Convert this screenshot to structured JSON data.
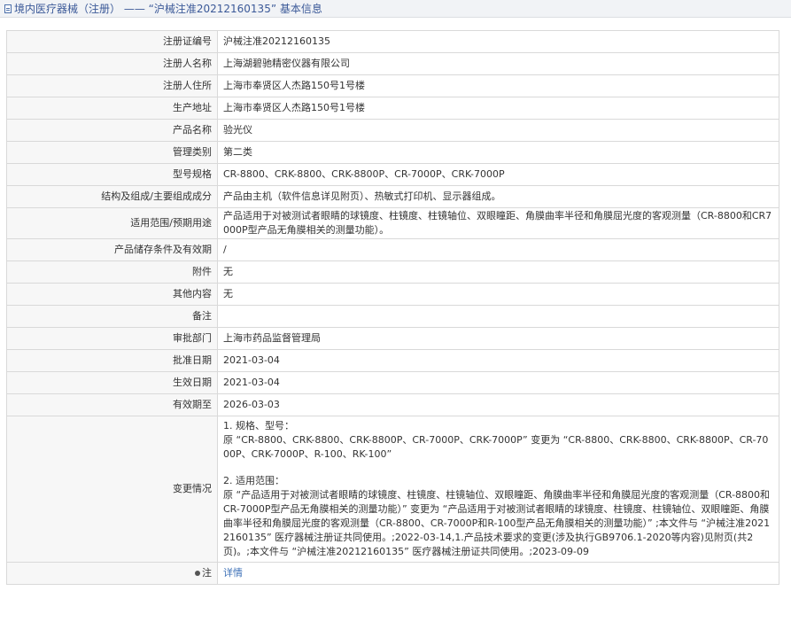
{
  "header": {
    "title": "境内医疗器械（注册） —— “沪械注准20212160135” 基本信息"
  },
  "rows": [
    {
      "label": "注册证编号",
      "value": "沪械注准20212160135"
    },
    {
      "label": "注册人名称",
      "value": "上海湖碧驰精密仪器有限公司"
    },
    {
      "label": "注册人住所",
      "value": "上海市奉贤区人杰路150号1号楼"
    },
    {
      "label": "生产地址",
      "value": "上海市奉贤区人杰路150号1号楼"
    },
    {
      "label": "产品名称",
      "value": "验光仪"
    },
    {
      "label": "管理类别",
      "value": "第二类"
    },
    {
      "label": "型号规格",
      "value": "CR-8800、CRK-8800、CRK-8800P、CR-7000P、CRK-7000P"
    },
    {
      "label": "结构及组成/主要组成成分",
      "value": "产品由主机（软件信息详见附页）、热敏式打印机、显示器组成。"
    },
    {
      "label": "适用范围/预期用途",
      "value": "产品适用于对被测试者眼睛的球镜度、柱镜度、柱镜轴位、双眼瞳距、角膜曲率半径和角膜屈光度的客观测量（CR-8800和CR7000P型产品无角膜相关的测量功能）。"
    },
    {
      "label": "产品储存条件及有效期",
      "value": "/"
    },
    {
      "label": "附件",
      "value": "无"
    },
    {
      "label": "其他内容",
      "value": "无"
    },
    {
      "label": "备注",
      "value": ""
    },
    {
      "label": "审批部门",
      "value": "上海市药品监督管理局"
    },
    {
      "label": "批准日期",
      "value": "2021-03-04"
    },
    {
      "label": "生效日期",
      "value": "2021-03-04"
    },
    {
      "label": "有效期至",
      "value": "2026-03-03"
    }
  ],
  "change": {
    "label": "变更情况",
    "line1": "1. 规格、型号：",
    "line2": "原 “CR-8800、CRK-8800、CRK-8800P、CR-7000P、CRK-7000P” 变更为 “CR-8800、CRK-8800、CRK-8800P、CR-7000P、CRK-7000P、R-100、RK-100”",
    "line3": "2. 适用范围：",
    "line4": "原 “产品适用于对被测试者眼睛的球镜度、柱镜度、柱镜轴位、双眼瞳距、角膜曲率半径和角膜屈光度的客观测量（CR-8800和CR-7000P型产品无角膜相关的测量功能）” 变更为 “产品适用于对被测试者眼睛的球镜度、柱镜度、柱镜轴位、双眼瞳距、角膜曲率半径和角膜屈光度的客观测量（CR-8800、CR-7000P和R-100型产品无角膜相关的测量功能）” ;本文件与 “沪械注准20212160135” 医疗器械注册证共同使用。;2022-03-14,1.产品技术要求的变更(涉及执行GB9706.1-2020等内容)见附页(共2页)。;本文件与 “沪械注准20212160135” 医疗器械注册证共同使用。;2023-09-09"
  },
  "note": {
    "label": "注",
    "link": "详情",
    "icon": "pin-icon"
  }
}
